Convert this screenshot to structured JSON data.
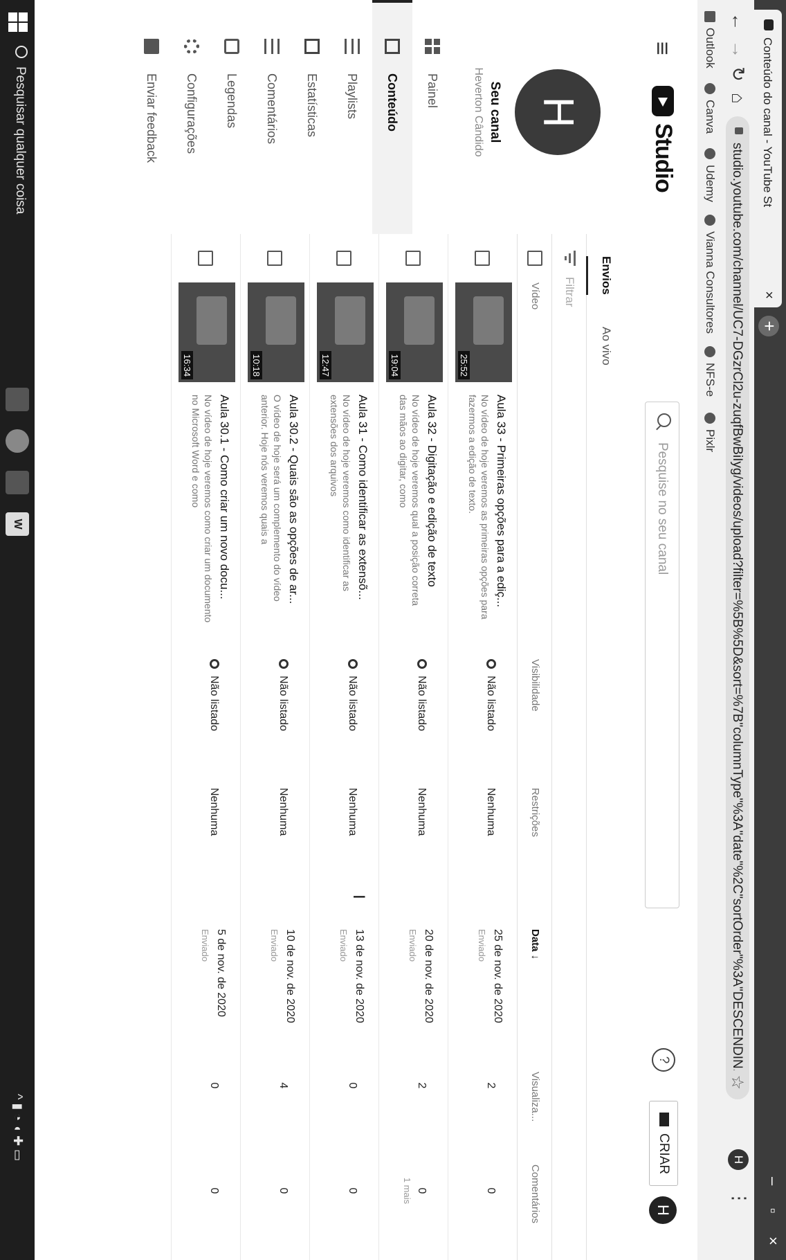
{
  "browser": {
    "tab_title": "Conteúdo do canal - YouTube St",
    "tab_close": "×",
    "new_tab": "+",
    "url": "studio.youtube.com/channel/UC7-DGzrCl2u-zuqfBwBiIyg/videos/upload?filter=%5B%5D&sort=%7B\"columnType\"%3A\"date\"%2C\"sortOrder\"%3A\"DESCENDIN...",
    "profile_initial": "H",
    "bookmarks": [
      {
        "label": "Outlook"
      },
      {
        "label": "Canva"
      },
      {
        "label": "Udemy"
      },
      {
        "label": "Vianna Consultores"
      },
      {
        "label": "NFS-e"
      },
      {
        "label": "Pixlr"
      }
    ]
  },
  "header": {
    "logo_text": "Studio",
    "search_placeholder": "Pesquise no seu canal",
    "help": "?",
    "create_label": "CRIAR",
    "avatar_initial": "H"
  },
  "sidebar": {
    "channel_initial": "H",
    "channel_title": "Seu canal",
    "channel_name": "Heverton Cândido",
    "items": [
      {
        "label": "Painel",
        "icon": "dashboard-icon"
      },
      {
        "label": "Conteúdo",
        "icon": "content-icon",
        "active": true
      },
      {
        "label": "Playlists",
        "icon": "playlists-icon"
      },
      {
        "label": "Estatísticas",
        "icon": "analytics-icon"
      },
      {
        "label": "Comentários",
        "icon": "comments-icon"
      },
      {
        "label": "Legendas",
        "icon": "subtitles-icon"
      },
      {
        "label": "Configurações",
        "icon": "gear-icon"
      },
      {
        "label": "Enviar feedback",
        "icon": "feedback-icon"
      }
    ]
  },
  "content": {
    "tabs": [
      {
        "label": "Envios",
        "active": true
      },
      {
        "label": "Ao vivo"
      }
    ],
    "filter_label": "Filtrar",
    "columns": {
      "video": "Vídeo",
      "visibility": "Visibilidade",
      "restrictions": "Restrições",
      "date": "Data ↓",
      "views": "Visualiza...",
      "comments": "Comentários"
    },
    "rows": [
      {
        "duration": "25:52",
        "title": "Aula 33 - Primeiras opções para a ediç...",
        "description": "No vídeo de hoje veremos as primeiras opções para fazermos a edição de texto.",
        "visibility": "Não listado",
        "restrictions": "Nenhuma",
        "date": "25 de nov. de 2020",
        "date_status": "Enviado",
        "views": "2",
        "comments": "0",
        "comments_sub": ""
      },
      {
        "duration": "19:04",
        "title": "Aula 32 - Digitação e edição de texto",
        "description": "No vídeo de hoje veremos qual a posição correta das mãos ao digitar, como",
        "visibility": "Não listado",
        "restrictions": "Nenhuma",
        "date": "20 de nov. de 2020",
        "date_status": "Enviado",
        "views": "2",
        "comments": "0",
        "comments_sub": "1 mais"
      },
      {
        "duration": "12:47",
        "title": "Aula 31 - Como identificar as extensõ...",
        "description": "No vídeo de hoje veremos como identificar as extensões dos arquivos",
        "visibility": "Não listado",
        "restrictions": "Nenhuma",
        "date": "13 de nov. de 2020",
        "date_status": "Enviado",
        "views": "0",
        "comments": "0",
        "comments_sub": ""
      },
      {
        "duration": "10:18",
        "title": "Aula 30.2 - Quais são as opções de ar...",
        "description": "O vídeo de hoje será um complemento do vídeo anterior. Hoje nós veremos quais a",
        "visibility": "Não listado",
        "restrictions": "Nenhuma",
        "date": "10 de nov. de 2020",
        "date_status": "Enviado",
        "views": "4",
        "comments": "0",
        "comments_sub": ""
      },
      {
        "duration": "16:34",
        "title": "Aula 30.1 - Como criar um novo docu...",
        "description": "No vídeo de hoje veremos como criar um documento no Microsoft Word e como",
        "visibility": "Não listado",
        "restrictions": "Nenhuma",
        "date": "5 de nov. de 2020",
        "date_status": "Enviado",
        "views": "0",
        "comments": "0",
        "comments_sub": ""
      }
    ]
  },
  "taskbar": {
    "search_text": "Pesquisar qualquer coisa"
  }
}
